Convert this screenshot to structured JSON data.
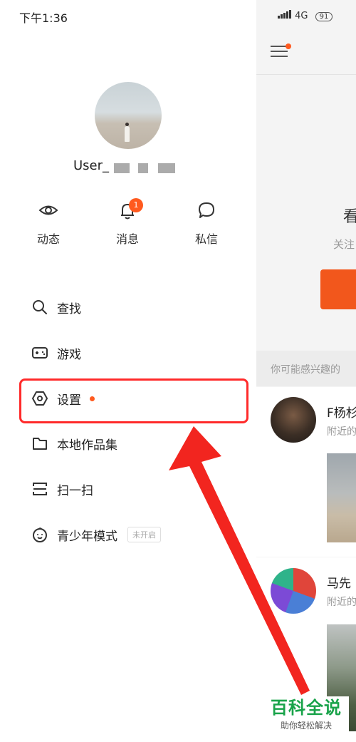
{
  "status_bar": {
    "time": "下午1:36",
    "network": "4G",
    "battery": "91"
  },
  "profile": {
    "username": "User_"
  },
  "quick_actions": [
    {
      "label": "动态",
      "icon": "eye-icon"
    },
    {
      "label": "消息",
      "icon": "bell-icon",
      "badge": "1"
    },
    {
      "label": "私信",
      "icon": "chat-bubble-icon"
    }
  ],
  "menu": [
    {
      "label": "查找",
      "icon": "search-icon"
    },
    {
      "label": "游戏",
      "icon": "gamepad-icon"
    },
    {
      "label": "设置",
      "icon": "hexagon-settings-icon",
      "dot": true
    },
    {
      "label": "本地作品集",
      "icon": "folder-icon"
    },
    {
      "label": "扫一扫",
      "icon": "scan-icon"
    },
    {
      "label": "青少年模式",
      "icon": "child-face-icon",
      "tag": "未开启"
    }
  ],
  "feed": {
    "title": "看",
    "subtitle": "关注",
    "suggest_text": "你可能感兴趣的",
    "cards": [
      {
        "name": "F杨杉",
        "sub": "附近的"
      },
      {
        "name": "马先",
        "sub": "附近的"
      }
    ]
  },
  "watermark": {
    "title": "百科全说",
    "subtitle": "助你轻松解决"
  },
  "colors": {
    "accent": "#ff5a1f",
    "highlight": "#ff2a2a",
    "watermark_green": "#19a34a"
  }
}
